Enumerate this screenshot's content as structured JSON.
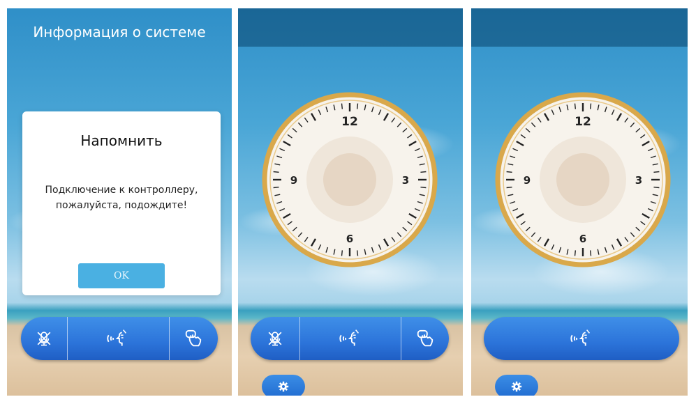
{
  "screen1": {
    "title": "Информация о системе",
    "dialog": {
      "title": "Напомнить",
      "message_line1": "Подключение к контроллеру,",
      "message_line2": "пожалуйста, подождите!",
      "ok_label": "OK"
    },
    "bar_icons": [
      "mute-icon",
      "voice-talk-icon",
      "unlock-hand-icon"
    ]
  },
  "screen2": {
    "clock_labels": [
      "12",
      "3",
      "6",
      "9"
    ],
    "bar_icons": [
      "mute-icon",
      "voice-talk-icon",
      "unlock-hand-icon"
    ],
    "settings_icon": "gear-icon"
  },
  "screen3": {
    "clock_labels": [
      "12",
      "3",
      "6",
      "9"
    ],
    "bar_icons": [
      "voice-talk-icon"
    ],
    "settings_icon": "gear-icon"
  },
  "colors": {
    "accent": "#2c74da",
    "ok_button": "#4ab0e2",
    "clock_rim": "#d9a84a"
  }
}
